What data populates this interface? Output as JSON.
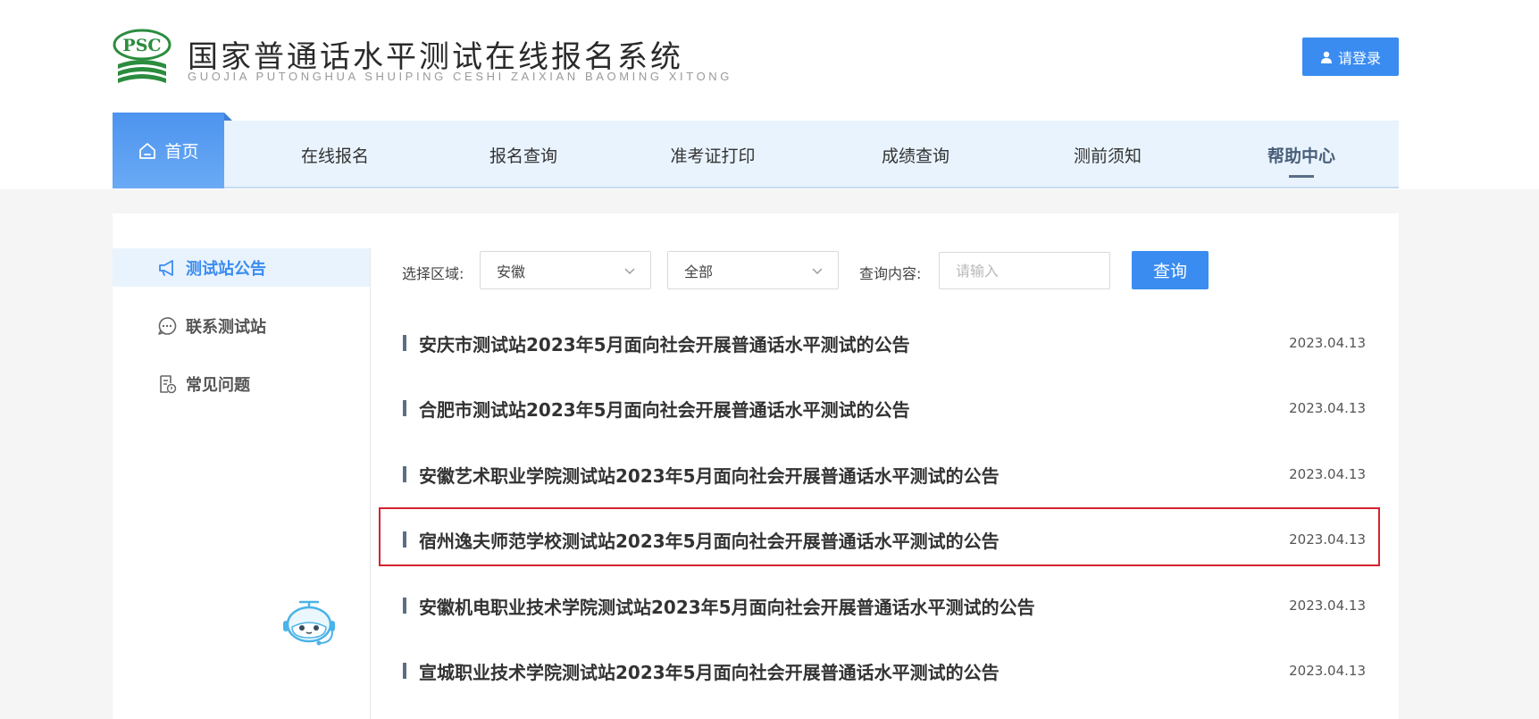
{
  "header": {
    "logo_text": "PSC",
    "title": "国家普通话水平测试在线报名系统",
    "subtitle": "GUOJIA PUTONGHUA SHUIPING CESHI ZAIXIAN BAOMING XITONG",
    "login_label": "请登录",
    "accent_color": "#3a8cf0"
  },
  "nav": {
    "home": "首页",
    "items": [
      "在线报名",
      "报名查询",
      "准考证打印",
      "成绩查询",
      "测前须知",
      "帮助中心"
    ],
    "active": "帮助中心"
  },
  "sidebar": {
    "items": [
      {
        "label": "测试站公告",
        "icon": "megaphone-icon",
        "active": true
      },
      {
        "label": "联系测试站",
        "icon": "chat-bubble-icon",
        "active": false
      },
      {
        "label": "常见问题",
        "icon": "document-question-icon",
        "active": false
      }
    ]
  },
  "filters": {
    "region_label": "选择区域:",
    "region_value": "安徽",
    "category_value": "全部",
    "query_label": "查询内容:",
    "query_placeholder": "请输入",
    "search_label": "查询"
  },
  "notices": [
    {
      "title": "安庆市测试站2023年5月面向社会开展普通话水平测试的公告",
      "date": "2023.04.13"
    },
    {
      "title": "合肥市测试站2023年5月面向社会开展普通话水平测试的公告",
      "date": "2023.04.13"
    },
    {
      "title": "安徽艺术职业学院测试站2023年5月面向社会开展普通话水平测试的公告",
      "date": "2023.04.13"
    },
    {
      "title": "宿州逸夫师范学校测试站2023年5月面向社会开展普通话水平测试的公告",
      "date": "2023.04.13"
    },
    {
      "title": "安徽机电职业技术学院测试站2023年5月面向社会开展普通话水平测试的公告",
      "date": "2023.04.13"
    },
    {
      "title": "宣城职业技术学院测试站2023年5月面向社会开展普通话水平测试的公告",
      "date": "2023.04.13"
    }
  ],
  "highlight_color": "#d5232e"
}
